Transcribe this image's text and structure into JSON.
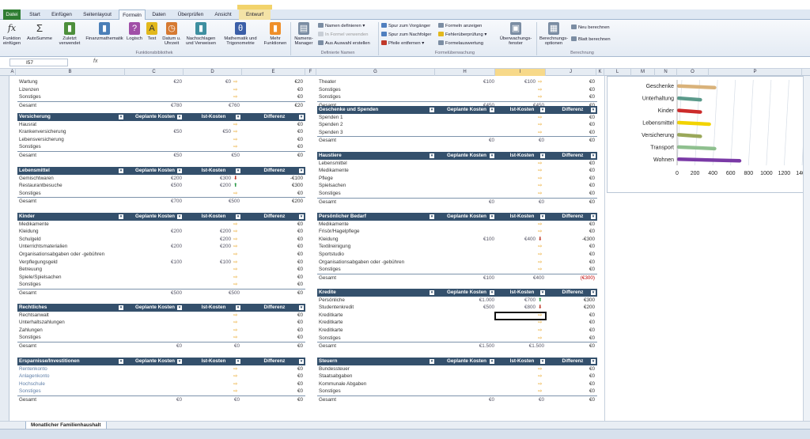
{
  "tabs": {
    "file": "Datei",
    "start": "Start",
    "insert": "Einfügen",
    "layout": "Seitenlayout",
    "formulas": "Formeln",
    "data": "Daten",
    "review": "Überprüfen",
    "view": "Ansicht",
    "design": "Entwurf"
  },
  "ribbon": {
    "insert_function": "Funktion\neinfügen",
    "autosum": "AutoSumme",
    "recent": "Zuletzt\nverwendet",
    "financial": "Finanzmathematik",
    "logical": "Logisch",
    "text": "Text",
    "datetime": "Datum u.\nUhrzeit",
    "lookup": "Nachschlagen\nund Verweisen",
    "math": "Mathematik und\nTrigonometrie",
    "more": "Mehr\nFunktionen",
    "library_label": "Funktionsbibliothek",
    "name_manager": "Namens-\nManager",
    "define_name": "Namen definieren",
    "use_in_formula": "In Formel verwenden",
    "create_from_selection": "Aus Auswahl erstellen",
    "names_label": "Definierte Namen",
    "trace_precedents": "Spur zum Vorgänger",
    "trace_dependents": "Spur zum Nachfolger",
    "remove_arrows": "Pfeile entfernen",
    "show_formulas": "Formeln anzeigen",
    "error_check": "Fehlerüberprüfung",
    "evaluate": "Formelauswertung",
    "watch_window": "Überwachungs-\nfenster",
    "audit_label": "Formelüberwachung",
    "calc_options": "Berechnungs-\noptionen",
    "calc_now": "Neu berechnen",
    "calc_sheet": "Blatt berechnen",
    "calc_label": "Berechnung"
  },
  "formula_bar": {
    "namebox": "I57",
    "fx": "fx"
  },
  "columns": [
    "A",
    "B",
    "C",
    "D",
    "E",
    "F",
    "G",
    "H",
    "I",
    "J",
    "K",
    "L",
    "M",
    "N",
    "O",
    "P"
  ],
  "col_headers": {
    "planned": "Geplante Kosten",
    "actual": "Ist-Kosten",
    "diff": "Differenz"
  },
  "total_label": "Gesamt",
  "left_tables": [
    {
      "title": "",
      "rows": [
        {
          "label": "Wartung",
          "p": "€20",
          "a": "€0",
          "d": "€20",
          "arrow": "right"
        },
        {
          "label": "Lizenzen",
          "p": "",
          "a": "",
          "d": "€0",
          "arrow": "right"
        },
        {
          "label": "Sonstiges",
          "p": "",
          "a": "",
          "d": "€0",
          "arrow": "right"
        }
      ],
      "total": {
        "p": "€780",
        "a": "€760",
        "d": "€20"
      }
    },
    {
      "title": "Versicherung",
      "rows": [
        {
          "label": "Hausrat",
          "p": "",
          "a": "",
          "d": "€0",
          "arrow": "right"
        },
        {
          "label": "Krankenversicherung",
          "p": "€50",
          "a": "€50",
          "d": "€0",
          "arrow": "right"
        },
        {
          "label": "Lebensversicherung",
          "p": "",
          "a": "",
          "d": "€0",
          "arrow": "right"
        },
        {
          "label": "Sonstiges",
          "p": "",
          "a": "",
          "d": "€0",
          "arrow": "right"
        }
      ],
      "total": {
        "p": "€50",
        "a": "€50",
        "d": "€0"
      }
    },
    {
      "title": "Lebensmittel",
      "rows": [
        {
          "label": "Gemischtwaren",
          "p": "€200",
          "a": "€300",
          "d": "-€100",
          "arrow": "down"
        },
        {
          "label": "Restaurantbesuche",
          "p": "€500",
          "a": "€200",
          "d": "€300",
          "arrow": "up"
        },
        {
          "label": "Sonstiges",
          "p": "",
          "a": "",
          "d": "€0",
          "arrow": "right"
        }
      ],
      "total": {
        "p": "€700",
        "a": "€500",
        "d": "€200"
      }
    },
    {
      "title": "Kinder",
      "rows": [
        {
          "label": "Medikamente",
          "p": "",
          "a": "",
          "d": "€0",
          "arrow": "right"
        },
        {
          "label": "Kleidung",
          "p": "€200",
          "a": "€200",
          "d": "€0",
          "arrow": "right"
        },
        {
          "label": "Schulgeld",
          "p": "",
          "a": "€200",
          "d": "€0",
          "arrow": "right"
        },
        {
          "label": "Unterrichtsmaterialien",
          "p": "€200",
          "a": "€200",
          "d": "€0",
          "arrow": "right"
        },
        {
          "label": "Organisationsabgaben oder -gebühren",
          "p": "",
          "a": "",
          "d": "€0",
          "arrow": "right"
        },
        {
          "label": "Verpflegungsgeld",
          "p": "€100",
          "a": "€100",
          "d": "€0",
          "arrow": "right"
        },
        {
          "label": "Betreuung",
          "p": "",
          "a": "",
          "d": "€0",
          "arrow": "right"
        },
        {
          "label": "Spiele/Spielsachen",
          "p": "",
          "a": "",
          "d": "€0",
          "arrow": "right"
        },
        {
          "label": "Sonstiges",
          "p": "",
          "a": "",
          "d": "€0",
          "arrow": "right"
        }
      ],
      "total": {
        "p": "€500",
        "a": "€500",
        "d": "€0"
      }
    },
    {
      "title": "Rechtliches",
      "rows": [
        {
          "label": "Rechtsanwalt",
          "p": "",
          "a": "",
          "d": "€0",
          "arrow": "right"
        },
        {
          "label": "Unterhaltszahlungen",
          "p": "",
          "a": "",
          "d": "€0",
          "arrow": "right"
        },
        {
          "label": "Zahlungen",
          "p": "",
          "a": "",
          "d": "€0",
          "arrow": "right"
        },
        {
          "label": "Sonstiges",
          "p": "",
          "a": "",
          "d": "€0",
          "arrow": "right"
        }
      ],
      "total": {
        "p": "€0",
        "a": "€0",
        "d": "€0"
      }
    },
    {
      "title": "Ersparnisse/Investitionen",
      "rows": [
        {
          "label": "Rentenkonto",
          "p": "",
          "a": "",
          "d": "€0",
          "arrow": "right"
        },
        {
          "label": "Anlagenkonto",
          "p": "",
          "a": "",
          "d": "€0",
          "arrow": "right"
        },
        {
          "label": "Hochschule",
          "p": "",
          "a": "",
          "d": "€0",
          "arrow": "right"
        },
        {
          "label": "Sonstiges",
          "p": "",
          "a": "",
          "d": "€0",
          "arrow": "right"
        }
      ],
      "total": {
        "p": "€0",
        "a": "€0",
        "d": "€0"
      }
    }
  ],
  "right_tables": [
    {
      "title": "",
      "rows": [
        {
          "label": "Theater",
          "p": "€100",
          "a": "€100",
          "d": "€0",
          "arrow": "right"
        },
        {
          "label": "Sonstiges",
          "p": "",
          "a": "",
          "d": "€0",
          "arrow": "right"
        },
        {
          "label": "Sonstiges",
          "p": "",
          "a": "",
          "d": "€0",
          "arrow": "right"
        }
      ],
      "total": {
        "p": "€450",
        "a": "€450",
        "d": "€0"
      }
    },
    {
      "title": "Geschenke und Spenden",
      "rows": [
        {
          "label": "Spenden 1",
          "p": "",
          "a": "",
          "d": "€0",
          "arrow": "right"
        },
        {
          "label": "Spenden 2",
          "p": "",
          "a": "",
          "d": "€0",
          "arrow": "right"
        },
        {
          "label": "Spenden 3",
          "p": "",
          "a": "",
          "d": "€0",
          "arrow": "right"
        }
      ],
      "total": {
        "p": "€0",
        "a": "€0",
        "d": "€0"
      }
    },
    {
      "title": "Haustiere",
      "rows": [
        {
          "label": "Lebensmittel",
          "p": "",
          "a": "",
          "d": "€0",
          "arrow": "right"
        },
        {
          "label": "Medikamente",
          "p": "",
          "a": "",
          "d": "€0",
          "arrow": "right"
        },
        {
          "label": "Pflege",
          "p": "",
          "a": "",
          "d": "€0",
          "arrow": "right"
        },
        {
          "label": "Spielsachen",
          "p": "",
          "a": "",
          "d": "€0",
          "arrow": "right"
        },
        {
          "label": "Sonstiges",
          "p": "",
          "a": "",
          "d": "€0",
          "arrow": "right"
        }
      ],
      "total": {
        "p": "€0",
        "a": "€0",
        "d": "€0"
      }
    },
    {
      "title": "Persönlicher Bedarf",
      "rows": [
        {
          "label": "Medikamente",
          "p": "",
          "a": "",
          "d": "€0",
          "arrow": "right"
        },
        {
          "label": "Frisör/Hagelpflege",
          "p": "",
          "a": "",
          "d": "€0",
          "arrow": "right"
        },
        {
          "label": "Kleidung",
          "p": "€100",
          "a": "€400",
          "d": "-€300",
          "arrow": "down"
        },
        {
          "label": "Textilreinigung",
          "p": "",
          "a": "",
          "d": "€0",
          "arrow": "right"
        },
        {
          "label": "Sportstudio",
          "p": "",
          "a": "",
          "d": "€0",
          "arrow": "right"
        },
        {
          "label": "Organisationsabgaben oder -gebühren",
          "p": "",
          "a": "",
          "d": "€0",
          "arrow": "right"
        },
        {
          "label": "Sonstiges",
          "p": "",
          "a": "",
          "d": "€0",
          "arrow": "right"
        }
      ],
      "total": {
        "p": "€100",
        "a": "€400",
        "d": "(€300)",
        "neg": true
      }
    },
    {
      "title": "Kredite",
      "rows": [
        {
          "label": "Persönliche",
          "p": "€1.000",
          "a": "€700",
          "d": "€300",
          "arrow": "up"
        },
        {
          "label": "Studentenkredit",
          "p": "€500",
          "a": "€800",
          "d": "€200",
          "arrow": "down"
        },
        {
          "label": "Kreditkarte",
          "p": "",
          "a": "",
          "d": "€0",
          "arrow": "right"
        },
        {
          "label": "Kreditkarte",
          "p": "",
          "a": "",
          "d": "€0",
          "arrow": "right"
        },
        {
          "label": "Kreditkarte",
          "p": "",
          "a": "",
          "d": "€0",
          "arrow": "right"
        },
        {
          "label": "Sonstiges",
          "p": "",
          "a": "",
          "d": "€0",
          "arrow": "right"
        }
      ],
      "total": {
        "p": "€1.500",
        "a": "€1.500",
        "d": "€0"
      }
    },
    {
      "title": "Steuern",
      "rows": [
        {
          "label": "Bundessteuer",
          "p": "",
          "a": "",
          "d": "€0",
          "arrow": "right"
        },
        {
          "label": "Staatsabgaben",
          "p": "",
          "a": "",
          "d": "€0",
          "arrow": "right"
        },
        {
          "label": "Kommunale Abgaben",
          "p": "",
          "a": "",
          "d": "€0",
          "arrow": "right"
        },
        {
          "label": "Sonstiges",
          "p": "",
          "a": "",
          "d": "€0",
          "arrow": "right"
        }
      ],
      "total": {
        "p": "€0",
        "a": "€0",
        "d": "€0"
      }
    }
  ],
  "sheet_tab": "Monatlicher Familienhaushalt",
  "colors": {
    "header_bg": "#34506c",
    "arrow_right": "#e8a21c",
    "arrow_down": "#c0392b",
    "arrow_up": "#2e9b4a",
    "neg": "#c00000"
  },
  "chart_data": {
    "type": "bar",
    "orientation": "horizontal",
    "categories": [
      "Geschenke",
      "Unterhaltung",
      "Kinder",
      "Lebensmittel",
      "Versicherung",
      "Transport",
      "Wohnen"
    ],
    "values": [
      420,
      260,
      260,
      360,
      260,
      420,
      700
    ],
    "colors": [
      "#d9b27a",
      "#5b9a8b",
      "#cc2b2b",
      "#f2d300",
      "#9aa85a",
      "#8fc08f",
      "#7a3aa6"
    ],
    "xticks": [
      "0",
      "200",
      "400",
      "600",
      "800",
      "1000",
      "1200",
      "1400"
    ],
    "xlim": [
      0,
      1400
    ],
    "grid": true
  }
}
